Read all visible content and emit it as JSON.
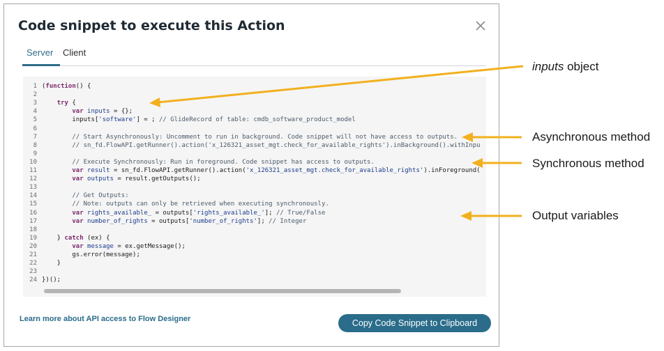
{
  "dialog": {
    "title": "Code snippet to execute this Action",
    "tabs": [
      "Server",
      "Client"
    ],
    "learn_link": "Learn more about API access to Flow Designer",
    "copy_button": "Copy Code Snippet to Clipboard"
  },
  "code_lines": [
    {
      "n": "1",
      "t": "(function() {"
    },
    {
      "n": "2",
      "t": ""
    },
    {
      "n": "3",
      "t": "    try {"
    },
    {
      "n": "4",
      "t": "        var inputs = {};"
    },
    {
      "n": "5",
      "t": "        inputs['software'] = ; // GlideRecord of table: cmdb_software_product_model"
    },
    {
      "n": "6",
      "t": ""
    },
    {
      "n": "7",
      "t": "        // Start Asynchronously: Uncomment to run in background. Code snippet will not have access to outputs."
    },
    {
      "n": "8",
      "t": "        // sn_fd.FlowAPI.getRunner().action('x_126321_asset_mgt.check_for_available_rights').inBackground().withInpu"
    },
    {
      "n": "9",
      "t": ""
    },
    {
      "n": "10",
      "t": "        // Execute Synchronously: Run in foreground. Code snippet has access to outputs."
    },
    {
      "n": "11",
      "t": "        var result = sn_fd.FlowAPI.getRunner().action('x_126321_asset_mgt.check_for_available_rights').inForeground("
    },
    {
      "n": "12",
      "t": "        var outputs = result.getOutputs();"
    },
    {
      "n": "13",
      "t": ""
    },
    {
      "n": "14",
      "t": "        // Get Outputs:"
    },
    {
      "n": "15",
      "t": "        // Note: outputs can only be retrieved when executing synchronously."
    },
    {
      "n": "16",
      "t": "        var rights_available_ = outputs['rights_available_']; // True/False"
    },
    {
      "n": "17",
      "t": "        var number_of_rights = outputs['number_of_rights']; // Integer"
    },
    {
      "n": "18",
      "t": ""
    },
    {
      "n": "19",
      "t": "    } catch (ex) {"
    },
    {
      "n": "20",
      "t": "        var message = ex.getMessage();"
    },
    {
      "n": "21",
      "t": "        gs.error(message);"
    },
    {
      "n": "22",
      "t": "    }"
    },
    {
      "n": "23",
      "t": ""
    },
    {
      "n": "24",
      "t": "})();"
    }
  ],
  "annotations": {
    "inputs_italic": "inputs",
    "inputs_rest": " object",
    "async": "Asynchronous method",
    "sync": "Synchronous method",
    "output": "Output variables"
  },
  "colors": {
    "accent": "#2a6c8a",
    "arrow": "#f2b01e"
  }
}
